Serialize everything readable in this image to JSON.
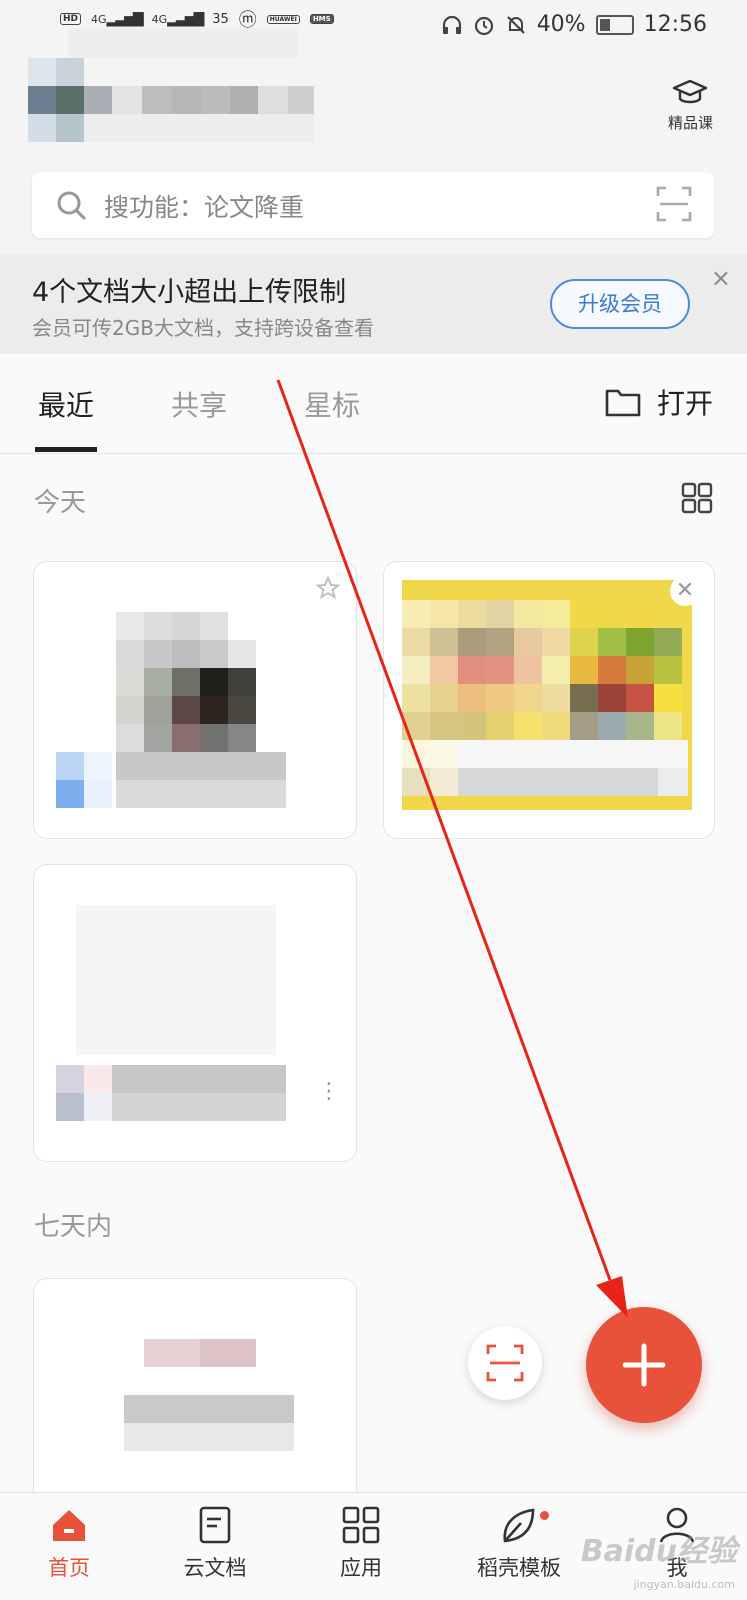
{
  "status_bar": {
    "network_left": "HD",
    "signal_1": "4G",
    "signal_2": "4G",
    "speed": "35",
    "notif_1": "HUAWEI",
    "notif_2": "HMS",
    "battery": "40%",
    "time": "12:56"
  },
  "header": {
    "course_label": "精品课"
  },
  "search": {
    "placeholder": "搜功能：论文降重"
  },
  "banner": {
    "title": "4个文档大小超出上传限制",
    "subtitle": "会员可传2GB大文档，支持跨设备查看",
    "upgrade_label": "升级会员",
    "close": "×"
  },
  "tabs": {
    "items": [
      {
        "label": "最近",
        "active": true
      },
      {
        "label": "共享",
        "active": false
      },
      {
        "label": "星标",
        "active": false
      }
    ],
    "open_label": "打开"
  },
  "sections": {
    "today": "今天",
    "week": "七天内"
  },
  "bottom_nav": {
    "items": [
      {
        "label": "首页",
        "icon": "home-icon",
        "active": true
      },
      {
        "label": "云文档",
        "icon": "cloud-doc-icon",
        "active": false
      },
      {
        "label": "应用",
        "icon": "apps-grid-icon",
        "active": false
      },
      {
        "label": "稻壳模板",
        "icon": "template-leaf-icon",
        "active": false
      },
      {
        "label": "我",
        "icon": "profile-icon",
        "active": false
      }
    ]
  },
  "watermark": {
    "brand": "Baidu经验",
    "url": "jingyan.baidu.com"
  },
  "colors": {
    "accent": "#e8513a",
    "link_blue": "#3b7bd1",
    "arrow_red": "#e8231a"
  }
}
